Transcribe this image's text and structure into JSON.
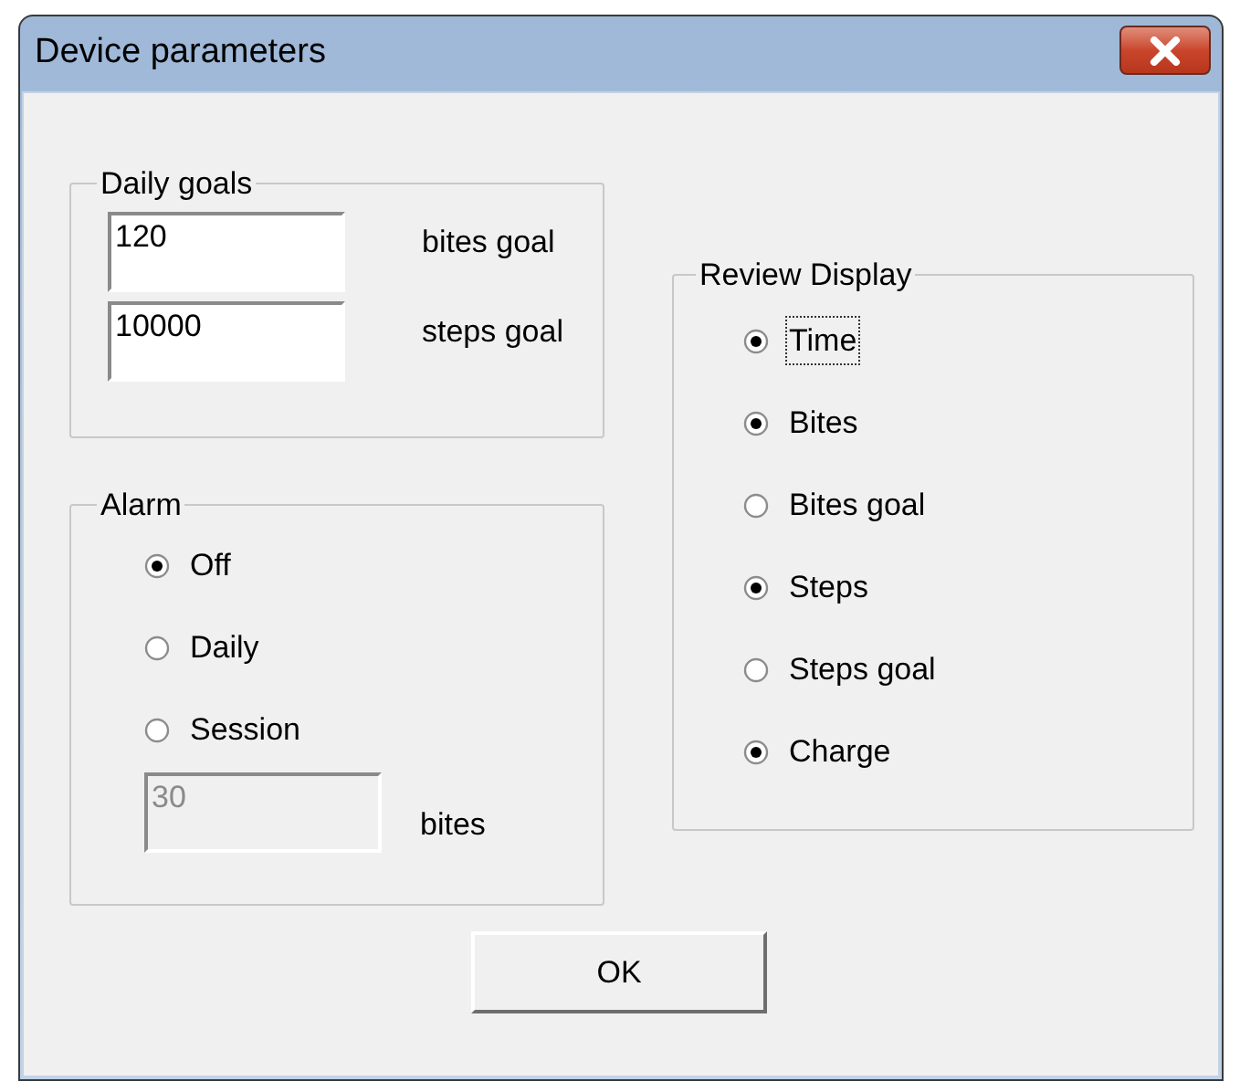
{
  "window": {
    "title": "Device parameters"
  },
  "daily_goals": {
    "title": "Daily goals",
    "fields": [
      {
        "value": "120",
        "label": "bites goal"
      },
      {
        "value": "10000",
        "label": "steps goal"
      }
    ]
  },
  "alarm": {
    "title": "Alarm",
    "options": [
      {
        "label": "Off",
        "selected": true
      },
      {
        "label": "Daily",
        "selected": false
      },
      {
        "label": "Session",
        "selected": false
      }
    ],
    "session_field": {
      "value": "30",
      "disabled": true,
      "label": "bites"
    }
  },
  "review_display": {
    "title": "Review Display",
    "options": [
      {
        "label": "Time",
        "checked": true,
        "focused": true
      },
      {
        "label": "Bites",
        "checked": true,
        "focused": false
      },
      {
        "label": "Bites goal",
        "checked": false,
        "focused": false
      },
      {
        "label": "Steps",
        "checked": true,
        "focused": false
      },
      {
        "label": "Steps goal",
        "checked": false,
        "focused": false
      },
      {
        "label": "Charge",
        "checked": true,
        "focused": false
      }
    ]
  },
  "buttons": [
    "OK"
  ]
}
